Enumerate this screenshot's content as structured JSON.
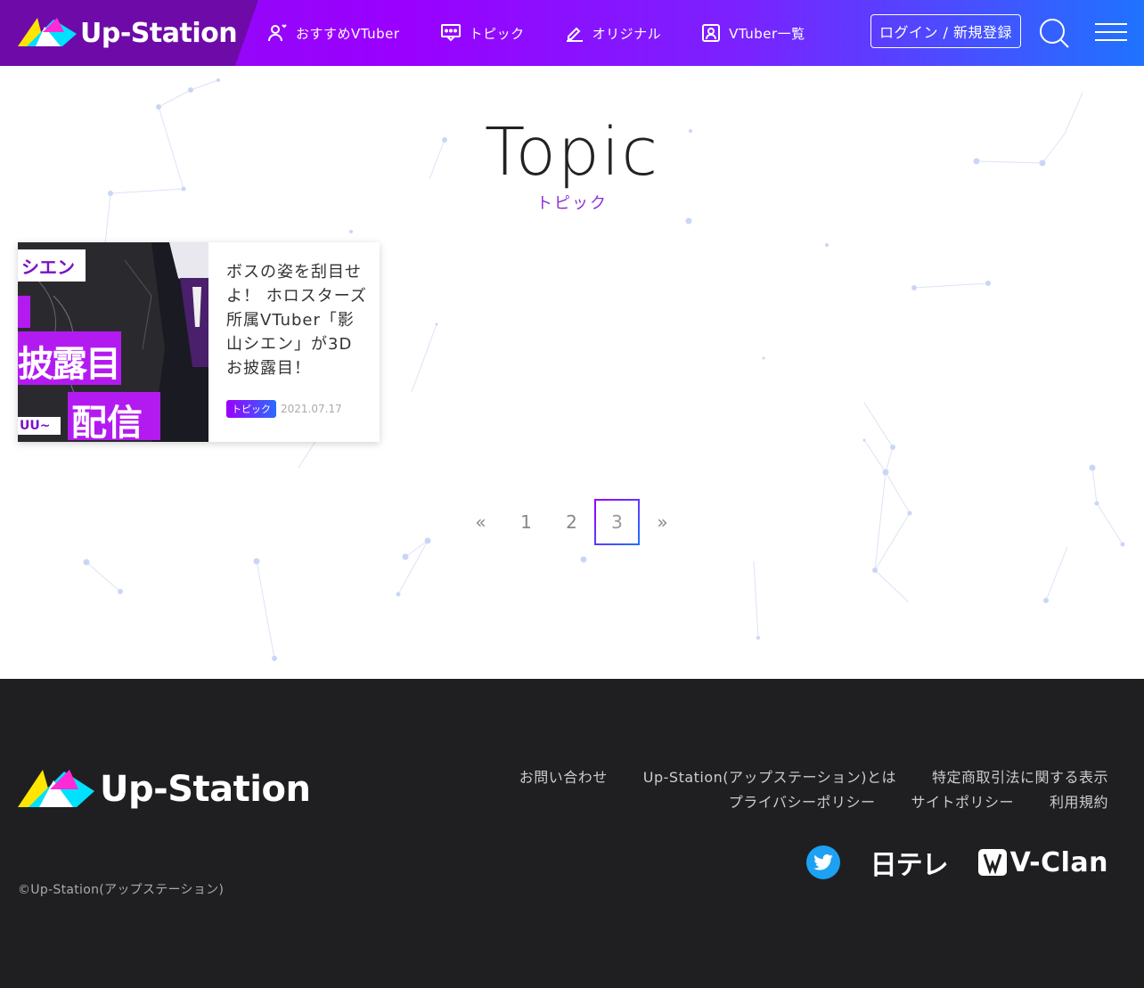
{
  "header": {
    "logo_text": "Up-Station",
    "nav": [
      {
        "label": "おすすめVTuber",
        "icon": "person-heart-icon"
      },
      {
        "label": "トピック",
        "icon": "chat-bubble-icon"
      },
      {
        "label": "オリジナル",
        "icon": "pen-icon"
      },
      {
        "label": "VTuber一覧",
        "icon": "profile-card-icon"
      }
    ],
    "login_label": "ログイン / 新規登録"
  },
  "hero": {
    "title": "Topic",
    "subtitle": "トピック"
  },
  "articles": [
    {
      "title": "ボスの姿を刮目せよ！ ホロスターズ所属VTuber「影山シエン」が3Dお披露目！",
      "tag": "トピック",
      "date": "2021.07.17",
      "thumb_text_top": "シエン",
      "thumb_text_mid": "披露目",
      "thumb_text_bot": "配信",
      "thumb_text_small": "UU~"
    }
  ],
  "pagination": {
    "prev": "«",
    "pages": [
      "1",
      "2",
      "3"
    ],
    "current": "3",
    "next": "»"
  },
  "footer": {
    "logo_text": "Up-Station",
    "links_row1": [
      "お問い合わせ",
      "Up-Station(アップステーション)とは",
      "特定商取引法に関する表示"
    ],
    "links_row2": [
      "プライバシーポリシー",
      "サイトポリシー",
      "利用規約"
    ],
    "ntv_text": "日テレ",
    "vclan_text": "V-Clan",
    "copyright": "©Up-Station(アップステーション)"
  },
  "colors": {
    "accent_purple": "#9a00ff",
    "accent_blue": "#1f73ff",
    "footer_bg": "#1f1f21",
    "twitter_blue": "#1da1f2"
  }
}
